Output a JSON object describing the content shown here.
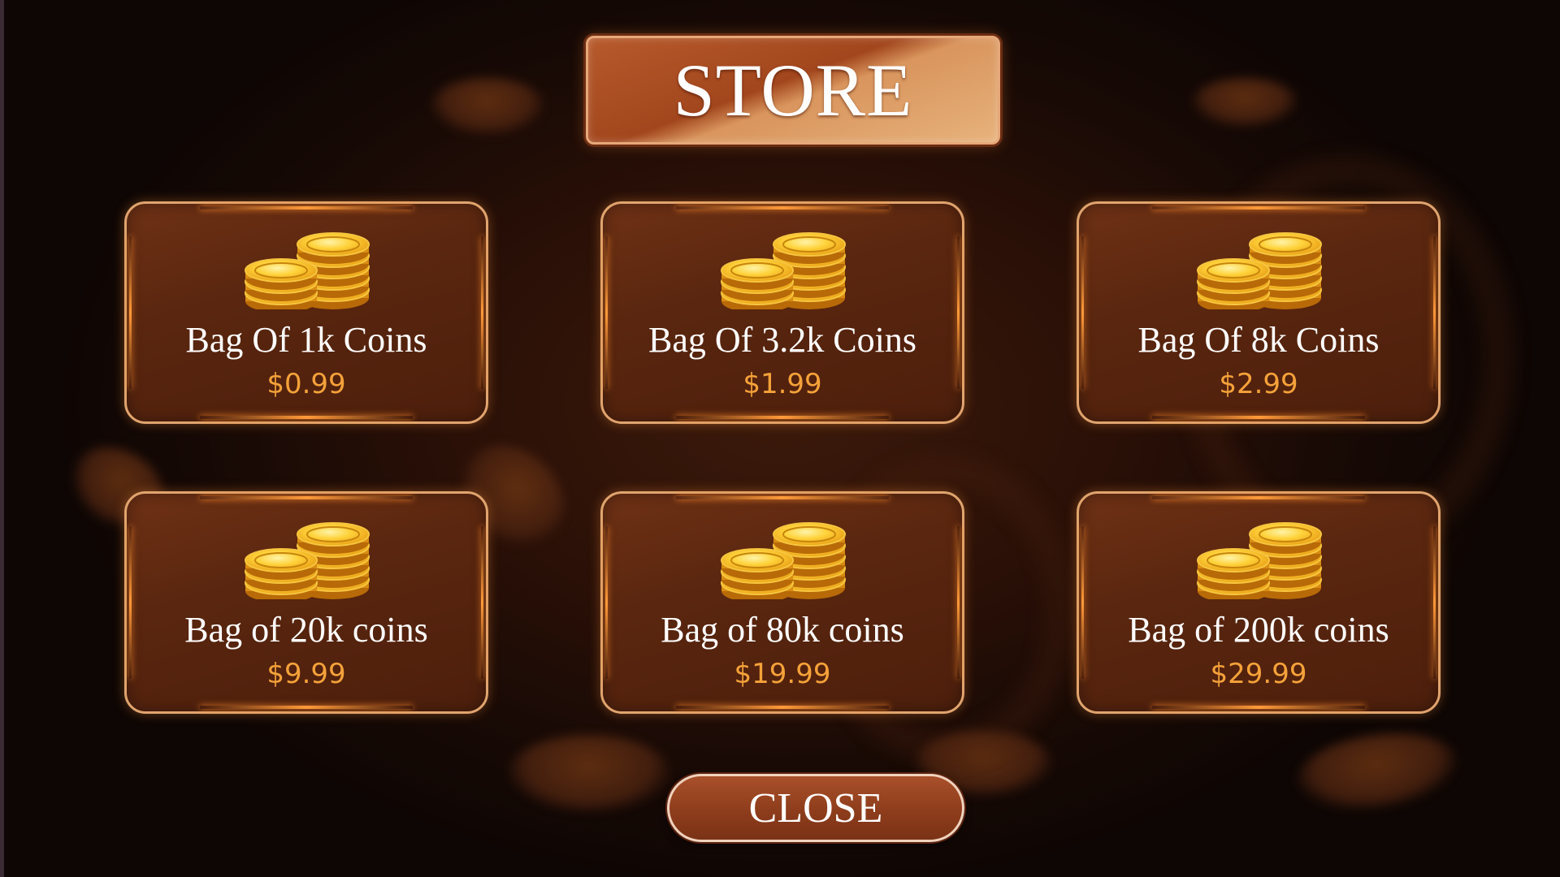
{
  "title": "STORE",
  "close_label": "CLOSE",
  "products": [
    {
      "name": "Bag Of 1k Coins",
      "price": "$0.99"
    },
    {
      "name": "Bag Of 3.2k Coins",
      "price": "$1.99"
    },
    {
      "name": "Bag Of 8k Coins",
      "price": "$2.99"
    },
    {
      "name": "Bag of 20k coins",
      "price": "$9.99"
    },
    {
      "name": "Bag of 80k coins",
      "price": "$19.99"
    },
    {
      "name": "Bag of 200k coins",
      "price": "$29.99"
    }
  ],
  "colors": {
    "price": "#f5a23a",
    "card_border": "#e0a46e",
    "accent_glow": "#ff9a3a"
  },
  "icons": {
    "product": "coin-stack-icon"
  }
}
